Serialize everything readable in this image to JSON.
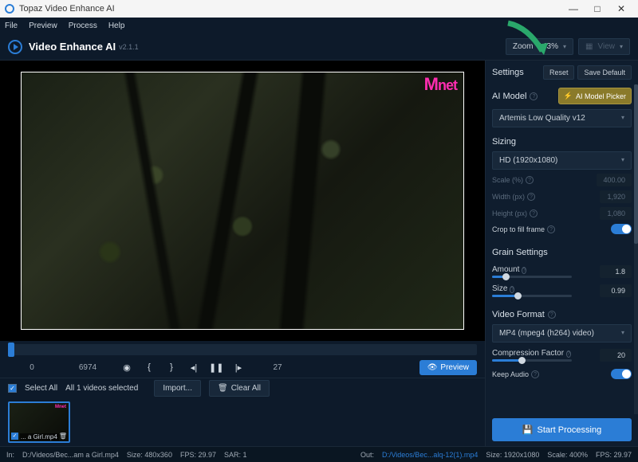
{
  "titlebar": {
    "app_name": "Topaz Video Enhance AI"
  },
  "menubar": {
    "items": [
      "File",
      "Preview",
      "Process",
      "Help"
    ]
  },
  "header": {
    "title": "Video Enhance AI",
    "version": "v2.1.1",
    "zoom_label": "Zoom",
    "zoom_value": "143%",
    "view_label": "View"
  },
  "preview": {
    "watermark": "net"
  },
  "timeline": {
    "start_frame": "0",
    "end_frame": "6974",
    "current_frame": "27"
  },
  "controls": {
    "preview_label": "Preview"
  },
  "selectbar": {
    "select_all": "Select All",
    "selected_text": "All 1 videos selected",
    "import": "Import...",
    "clear_all": "Clear All"
  },
  "thumb": {
    "name": "... a Girl.mp4"
  },
  "settings": {
    "title": "Settings",
    "reset": "Reset",
    "save_default": "Save Default",
    "ai_model_label": "AI Model",
    "picker_label": "AI Model Picker",
    "model_value": "Artemis Low Quality v12",
    "sizing_label": "Sizing",
    "size_preset": "HD (1920x1080)",
    "scale_label": "Scale (%)",
    "scale_value": "400.00",
    "width_label": "Width (px)",
    "width_value": "1,920",
    "height_label": "Height (px)",
    "height_value": "1,080",
    "crop_label": "Crop to fill frame",
    "grain_label": "Grain Settings",
    "amount_label": "Amount",
    "amount_value": "1.8",
    "size_label": "Size",
    "size_value": "0.99",
    "format_label": "Video Format",
    "format_value": "MP4 (mpeg4 (h264) video)",
    "compression_label": "Compression Factor",
    "compression_value": "20",
    "keep_audio_label": "Keep Audio",
    "start_label": "Start Processing"
  },
  "statusbar": {
    "in_label": "In:",
    "in_path": "D:/Videos/Bec...am a Girl.mp4",
    "in_size": "Size: 480x360",
    "in_fps": "FPS: 29.97",
    "in_sar": "SAR: 1",
    "out_label": "Out:",
    "out_path": "D:/Videos/Bec...alq-12(1).mp4",
    "out_size": "Size: 1920x1080",
    "out_scale": "Scale: 400%",
    "out_fps": "FPS: 29.97"
  }
}
